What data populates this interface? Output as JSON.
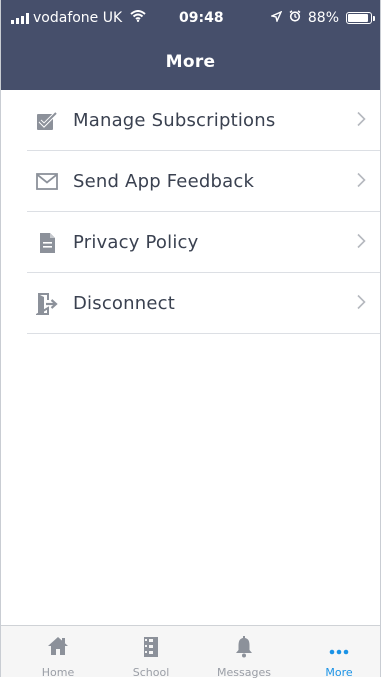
{
  "status_bar": {
    "carrier": "vodafone UK",
    "time": "09:48",
    "battery": "88%",
    "battery_level": 0.88
  },
  "header": {
    "title": "More"
  },
  "menu": {
    "items": [
      {
        "label": "Manage Subscriptions",
        "icon": "checkbox-icon"
      },
      {
        "label": "Send App Feedback",
        "icon": "envelope-icon"
      },
      {
        "label": "Privacy Policy",
        "icon": "document-icon"
      },
      {
        "label": "Disconnect",
        "icon": "sign-out-icon"
      }
    ]
  },
  "tabbar": {
    "tabs": [
      {
        "label": "Home",
        "icon": "home-icon"
      },
      {
        "label": "School",
        "icon": "school-icon"
      },
      {
        "label": "Messages",
        "icon": "bell-icon"
      },
      {
        "label": "More",
        "icon": "more-dots-icon",
        "active": true
      }
    ]
  },
  "colors": {
    "header_bg": "#464f6b",
    "active_tab": "#1b93e6",
    "icon_gray": "#8c919a"
  }
}
